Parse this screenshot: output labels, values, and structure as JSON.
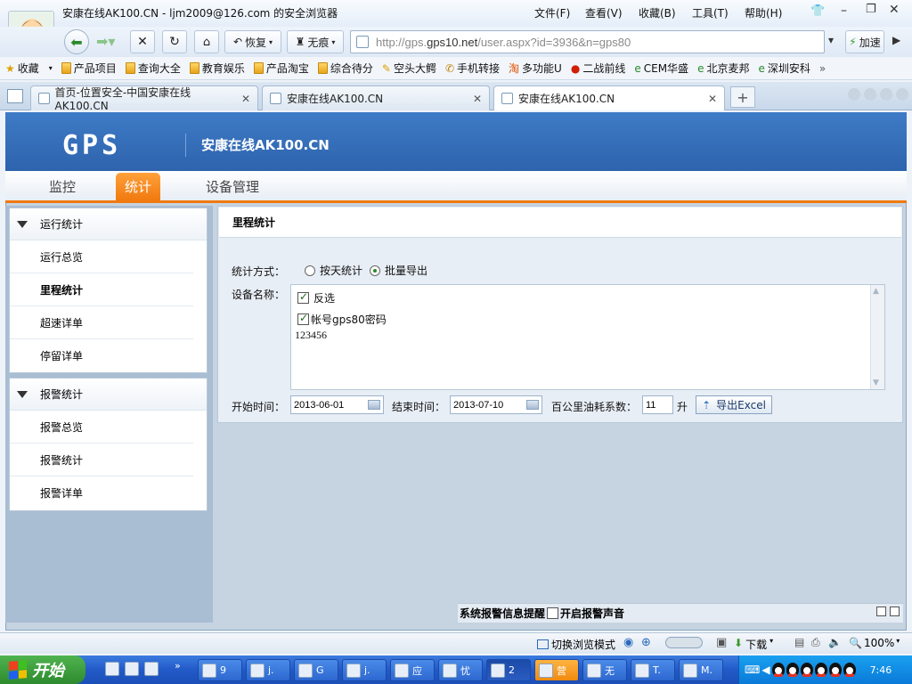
{
  "browser": {
    "title": "安康在线AK100.CN - ljm2009@126.com 的安全浏览器",
    "menu": [
      "文件(F)",
      "查看(V)",
      "收藏(B)",
      "工具(T)",
      "帮助(H)"
    ],
    "nav": {
      "restore_label": "恢复",
      "incognito_label": "无痕",
      "speed_label": "加速"
    },
    "address_prefix": "http://gps.",
    "address_domain": "gps10.net",
    "address_suffix": "/user.aspx?id=3936&n=gps80",
    "bookmarks_label": "收藏",
    "bookmarks": [
      "产品项目",
      "查询大全",
      "教育娱乐",
      "产品淘宝",
      "综合待分",
      "空头大鳄",
      "手机转接",
      "多功能U",
      "二战前线",
      "CEM华盛",
      "北京麦邦",
      "深圳安科"
    ],
    "tabs": [
      {
        "label": "首页-位置安全-中国安康在线AK100.CN"
      },
      {
        "label": "安康在线AK100.CN"
      },
      {
        "label": "安康在线AK100.CN"
      }
    ],
    "status": {
      "switch_mode": "切换浏览模式",
      "download": "下载",
      "zoom": "100%"
    }
  },
  "site": {
    "logo": "GPS",
    "title": "安康在线AK100.CN",
    "nav": [
      "监控",
      "统计",
      "设备管理"
    ],
    "active_nav": 1
  },
  "sidebar": {
    "groups": [
      {
        "title": "运行统计",
        "items": [
          "运行总览",
          "里程统计",
          "超速详单",
          "停留详单"
        ]
      },
      {
        "title": "报警统计",
        "items": [
          "报警总览",
          "报警统计",
          "报警详单"
        ]
      }
    ],
    "active_item": "里程统计"
  },
  "content": {
    "title": "里程统计",
    "stat_method_label": "统计方式：",
    "stat_options": [
      "按天统计",
      "批量导出"
    ],
    "selected_option": "批量导出",
    "device_label": "设备名称：",
    "invert_label": "反选",
    "device_entry": "帐号gps80密码",
    "device_password": "123456",
    "start_label": "开始时间：",
    "start_value": "2013-06-01",
    "end_label": "结束时间：",
    "end_value": "2013-07-10",
    "fuel_label": "百公里油耗系数：",
    "fuel_value": "11",
    "fuel_unit": "升",
    "export_label": "导出Excel"
  },
  "alarm": {
    "title": "系统报警信息提醒",
    "sound_label": "开启报警声音"
  },
  "taskbar": {
    "start": "开始",
    "items": [
      "9",
      "j.",
      "G",
      "j.",
      "应",
      "忧",
      "2",
      "营",
      "无",
      "T.",
      "M."
    ],
    "time": "7:46"
  }
}
